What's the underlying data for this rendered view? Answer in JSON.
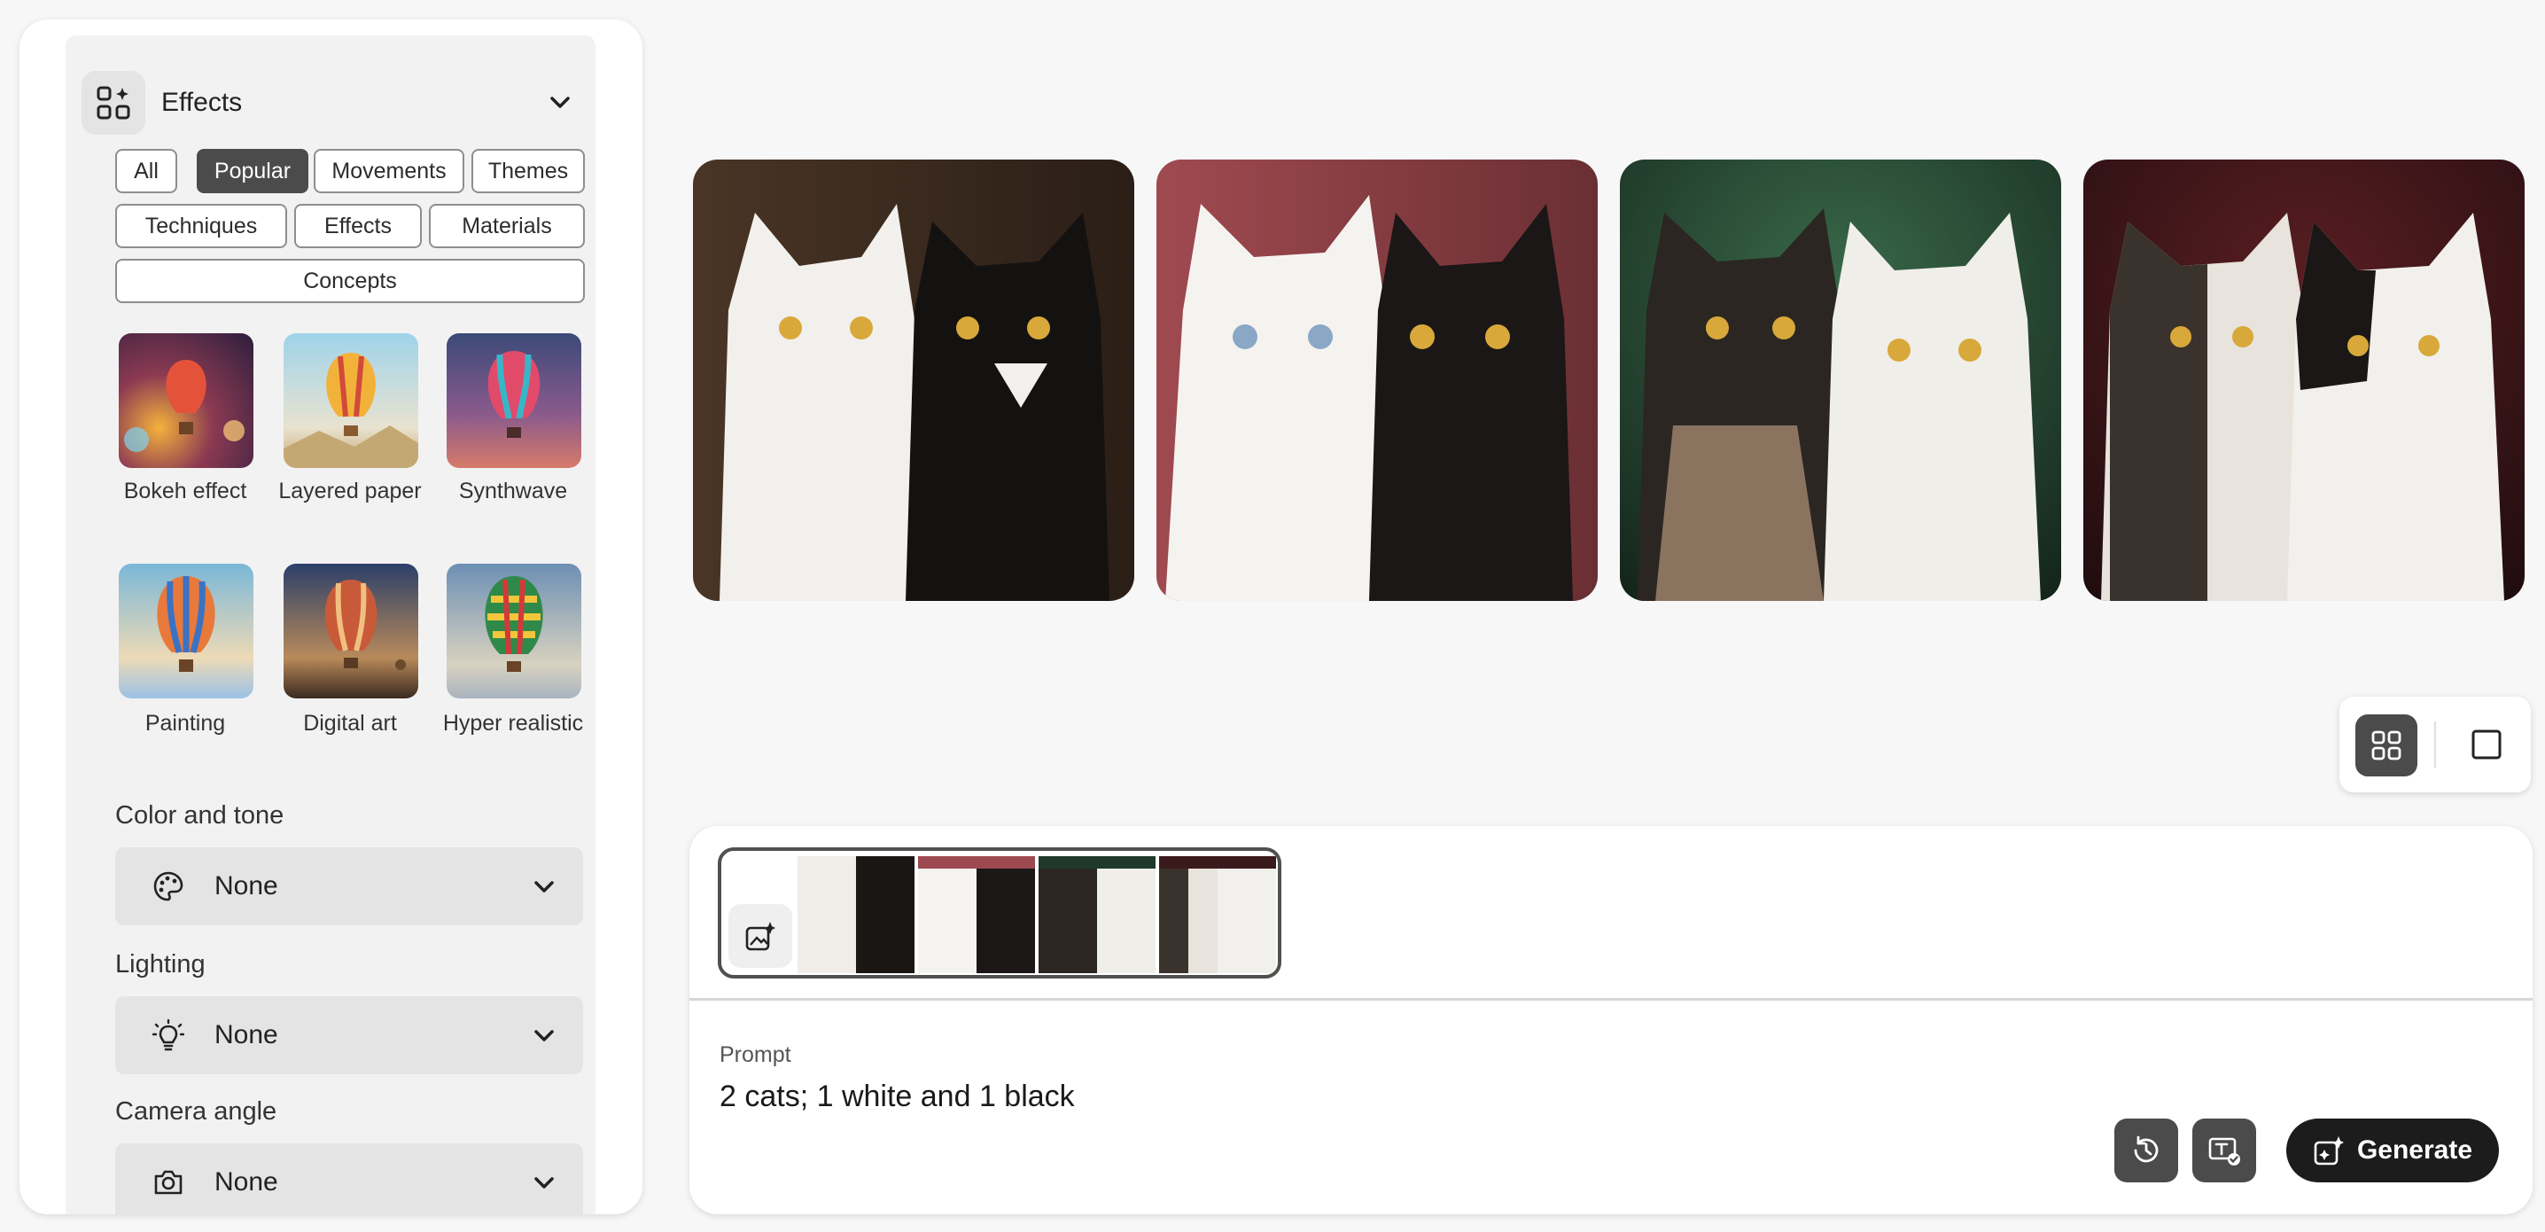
{
  "effects_panel": {
    "title": "Effects",
    "filters": [
      "All",
      "Popular",
      "Movements",
      "Themes",
      "Techniques",
      "Effects",
      "Materials",
      "Concepts"
    ],
    "active_filter": "Popular",
    "styles": [
      {
        "label": "Bokeh effect"
      },
      {
        "label": "Layered paper"
      },
      {
        "label": "Synthwave"
      },
      {
        "label": "Painting"
      },
      {
        "label": "Digital art"
      },
      {
        "label": "Hyper realistic"
      }
    ],
    "color_and_tone": {
      "label": "Color and tone",
      "value": "None",
      "icon": "palette-icon"
    },
    "lighting": {
      "label": "Lighting",
      "value": "None",
      "icon": "lightbulb-icon"
    },
    "camera_angle": {
      "label": "Camera angle",
      "value": "None",
      "icon": "camera-icon"
    }
  },
  "results": [
    {
      "name": "result-image-1",
      "bg": "#3a2c22"
    },
    {
      "name": "result-image-2",
      "bg": "#9c4a4f"
    },
    {
      "name": "result-image-3",
      "bg": "#1f3a2a"
    },
    {
      "name": "result-image-4",
      "bg": "#3a1a1c"
    }
  ],
  "view_toggle": {
    "active": "grid"
  },
  "composer": {
    "prompt_label": "Prompt",
    "prompt_text": "2 cats; 1 white and 1 black",
    "generate_label": "Generate"
  },
  "colors": {
    "accent_dark": "#1c1c1c",
    "chip_active": "#4b4b4b"
  }
}
